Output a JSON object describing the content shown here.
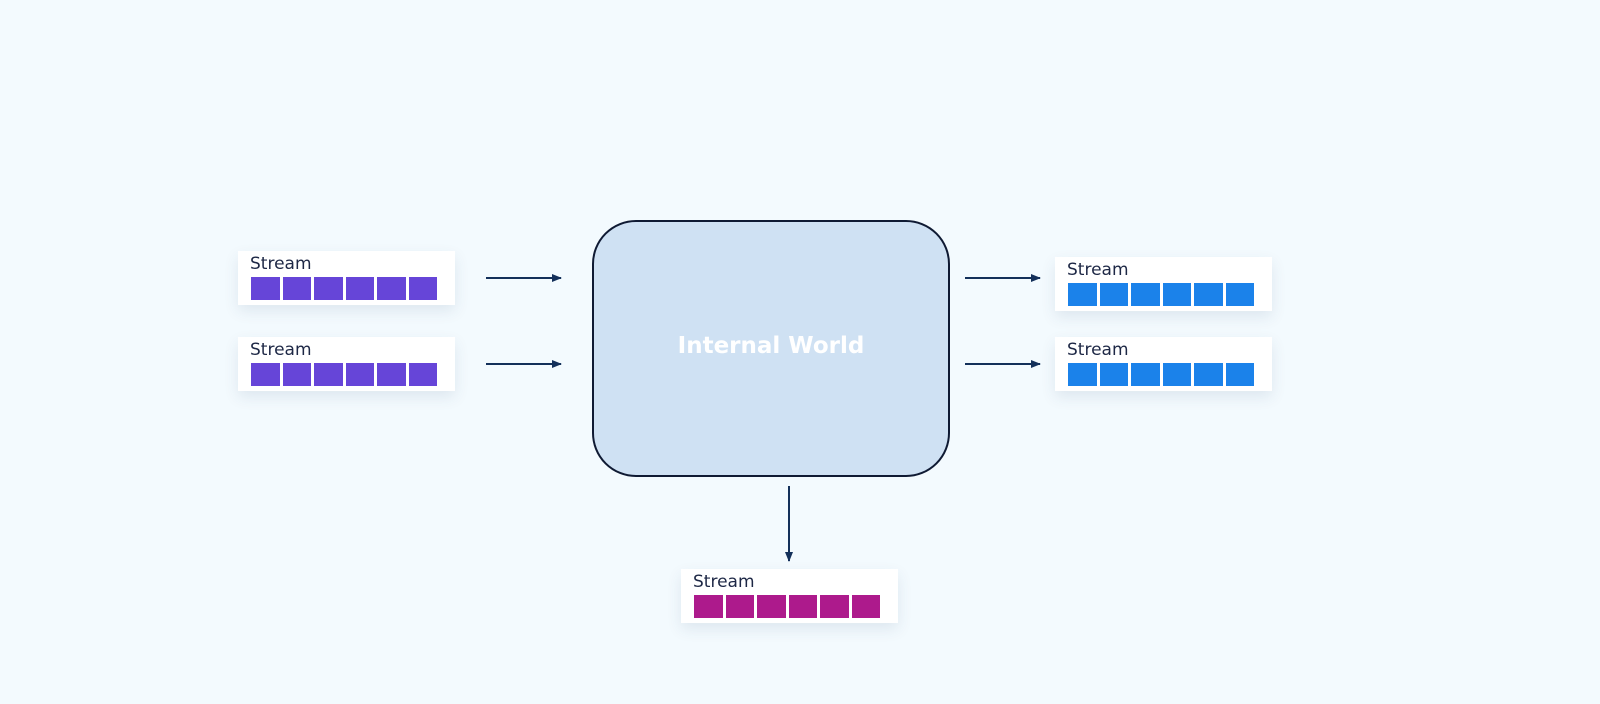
{
  "center": {
    "label": "Internal World"
  },
  "colors": {
    "input": "#6645d8",
    "output": "#1b82ea",
    "bottom": "#ad1a8c",
    "arrow": "#13305a"
  },
  "inputs": [
    {
      "label": "Stream",
      "cells": 6
    },
    {
      "label": "Stream",
      "cells": 6
    }
  ],
  "outputs": [
    {
      "label": "Stream",
      "cells": 6
    },
    {
      "label": "Stream",
      "cells": 6
    }
  ],
  "bottom": {
    "label": "Stream",
    "cells": 6
  }
}
